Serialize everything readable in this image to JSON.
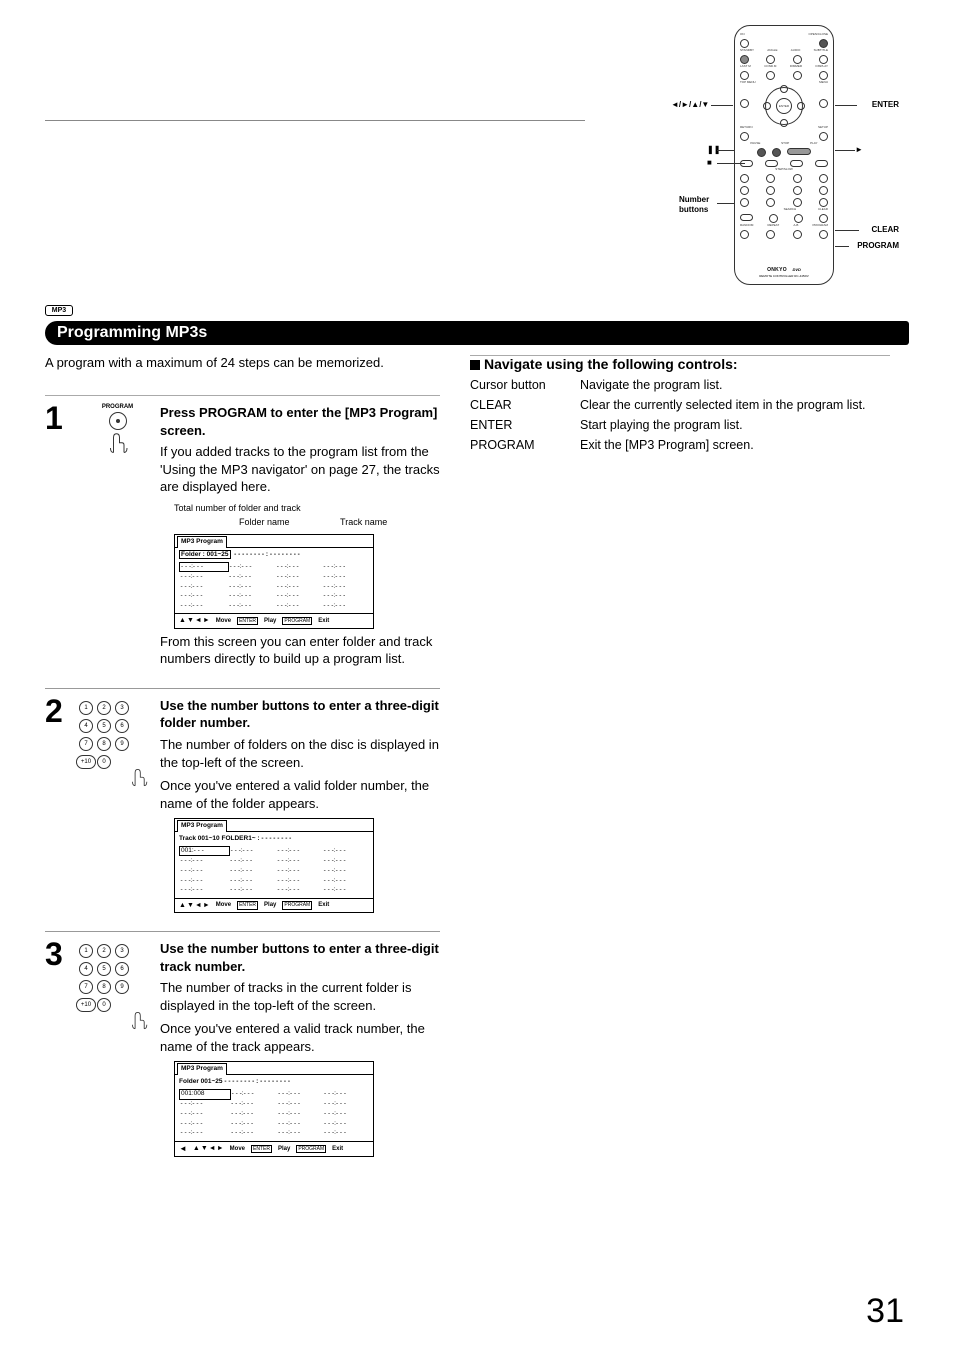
{
  "mp3_tag": "MP3",
  "title_bar": "Programming MP3s",
  "intro": "A program with a maximum of 24 steps can be memorized.",
  "remote_labels": {
    "enter": "ENTER",
    "arrows": "◄/►/▲/▼",
    "pause": "❚❚",
    "stop": "■",
    "play": "►",
    "number_buttons_1": "Number",
    "number_buttons_2": "buttons",
    "clear": "CLEAR",
    "program": "PROGRAM",
    "brand": "ONKYO",
    "controller": "REMOTE CONTROLLER  RC-445DV",
    "dvd": "DVD"
  },
  "remote_btn_labels": {
    "row1": [
      "ON",
      "",
      "",
      "OPEN/CLOSE"
    ],
    "row2": [
      "STANDBY",
      "ANGLE",
      "AUDIO",
      "SUBTITLE"
    ],
    "row3": [
      "LAST M",
      "COND.M",
      "DIMMER",
      "DISPLAY"
    ],
    "row4": [
      "TOP MENU",
      "",
      "",
      "MENU"
    ],
    "row5": [
      "RETURN",
      "",
      "",
      "SETUP"
    ],
    "row6": [
      "PAUSE",
      "STOP",
      "PLAY"
    ],
    "row7a": [
      "STEP/SLOW"
    ],
    "row8": [
      "RANDOM",
      "REPEAT",
      "A-B",
      "PROGRAM"
    ],
    "row9": [
      "",
      "",
      "SEARCH",
      "CLEAR"
    ]
  },
  "steps": [
    {
      "num": "1",
      "icon_label": "PROGRAM",
      "heading": "Press PROGRAM to enter the [MP3 Program] screen.",
      "body1": "If you added tracks to the program list from the 'Using the MP3 navigator' on page 27, the tracks are displayed here.",
      "callout_total": "Total number of folder and track",
      "callout_folder": "Folder name",
      "callout_track": "Track name",
      "body2": "From this screen you can enter folder and track numbers directly to build up a program list.",
      "ss": {
        "tab": "MP3 Program",
        "header": "Folder : 001~25",
        "header_right": "- - - - - - - - : - - - - - - - -",
        "cells": [
          "- - -:- - -",
          "- - -:- - -",
          "- - -:- - -",
          "- - -:- - -"
        ],
        "foot_arrows": "▲▼◄►",
        "foot_move": "Move",
        "foot_enter": "ENTER",
        "foot_play": "Play",
        "foot_program": "PROGRAM",
        "foot_exit": "Exit"
      }
    },
    {
      "num": "2",
      "heading": "Use the number buttons to enter a three-digit folder number.",
      "body1": "The number of folders on the disc is displayed in the top-left of the screen.",
      "body2": "Once you've entered a valid folder number, the name of the folder appears.",
      "ss": {
        "tab": "MP3 Program",
        "header": "Track    001~10      FOLDER1~ : - - - - - - - -",
        "first_cell": "001:- - -",
        "cells": [
          "- - -:- - -",
          "- - -:- - -",
          "- - -:- - -",
          "- - -:- - -"
        ],
        "foot_arrows": "▲▼◄►",
        "foot_move": "Move",
        "foot_enter": "ENTER",
        "foot_play": "Play",
        "foot_program": "PROGRAM",
        "foot_exit": "Exit"
      }
    },
    {
      "num": "3",
      "heading": "Use the number buttons to enter a three-digit track number.",
      "body1": "The number of tracks in the current folder is displayed in the top-left of the screen.",
      "body2": "Once you've entered a valid track number, the name of the track appears.",
      "ss": {
        "tab": "MP3 Program",
        "header": "Folder   001~25      - - - - - - - - : - - - - - - - -",
        "first_cell": "001:008",
        "cells": [
          "- - -:- - -",
          "- - -:- - -",
          "- - -:- - -",
          "- - -:- - -"
        ],
        "foot_left_arrow": "◄",
        "foot_arrows": "▲▼◄►",
        "foot_move": "Move",
        "foot_enter": "ENTER",
        "foot_play": "Play",
        "foot_program": "PROGRAM",
        "foot_exit": "Exit"
      }
    }
  ],
  "right_heading": "Navigate using the following controls:",
  "controls": [
    {
      "key": "Cursor button",
      "desc": "Navigate the program list."
    },
    {
      "key": "CLEAR",
      "desc": "Clear the currently selected item in the program list."
    },
    {
      "key": "ENTER",
      "desc": "Start playing the program list."
    },
    {
      "key": "PROGRAM",
      "desc": "Exit the [MP3 Program] screen."
    }
  ],
  "page_num": "31",
  "keys": [
    "1",
    "2",
    "3",
    "4",
    "5",
    "6",
    "7",
    "8",
    "9",
    "+10",
    "0"
  ]
}
